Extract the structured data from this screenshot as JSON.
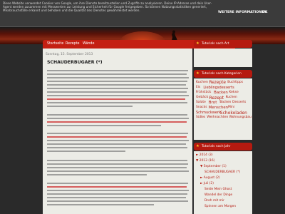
{
  "cookie": {
    "text": "Diese Website verwendet Cookies von Google, um ihre Dienste bereitzustellen und Zugriffe zu analysieren. Deine IP-Adresse und dein User-Agent werden zusammen mit Messwerten zur Leistung und Sicherheit für Google freigegeben. So können Nutzungsstatistiken generiert, Missbrauchsfälle erkannt und behoben und die Qualität des Dienstes gewährleistet werden.",
    "more_label": "WEITERE INFORMATIONEN",
    "ok_label": "OK"
  },
  "nav": {
    "items": [
      "Startseite",
      "Rezepte",
      "Wände"
    ]
  },
  "post": {
    "date": "Sonntag, 15. September 2013",
    "title": "SCHAUDERBUGAER (*)"
  },
  "sidebar": {
    "widgets": [
      {
        "title": "Tutorials nach Art"
      },
      {
        "title": "Tutorials nach Kategorien"
      },
      {
        "title": "Tutorials nach Jahr"
      }
    ],
    "tags": [
      {
        "label": "Kuchen",
        "size": 4.6
      },
      {
        "label": "Rezepte",
        "size": 5.8
      },
      {
        "label": "Buchtipps",
        "size": 4.4
      },
      {
        "label": "Eis",
        "size": 4.4
      },
      {
        "label": "Lieblingsdesserts",
        "size": 5.0
      },
      {
        "label": "Frühstück",
        "size": 4.4
      },
      {
        "label": "Backen",
        "size": 5.4
      },
      {
        "label": "Kekse",
        "size": 4.6
      },
      {
        "label": "Gebäck",
        "size": 4.6
      },
      {
        "label": "Rezept",
        "size": 6.0
      },
      {
        "label": "Kuchen",
        "size": 4.4
      },
      {
        "label": "Salate",
        "size": 4.4
      },
      {
        "label": "Brot",
        "size": 5.6
      },
      {
        "label": "Backen",
        "size": 4.4
      },
      {
        "label": "Desserts",
        "size": 4.4
      },
      {
        "label": "Snacks",
        "size": 4.4
      },
      {
        "label": "Menschen",
        "size": 5.4
      },
      {
        "label": "Mini",
        "size": 4.4
      },
      {
        "label": "Schmuckwerk",
        "size": 5.0
      },
      {
        "label": "Schokoladen",
        "size": 6.0
      },
      {
        "label": "Süßes",
        "size": 4.4
      },
      {
        "label": "Weihnachten",
        "size": 4.6
      },
      {
        "label": "Wohnungsbau",
        "size": 4.4
      }
    ],
    "archive": [
      "► 2014 (3)",
      "▼ 2013 (16)",
      "▼ September (1)",
      "SCHAUDERBUGAER (*)",
      "► August (2)",
      "► Juli (2)",
      "Seide Mein Ghost",
      "Wandel der Dinge",
      "Dreh mit mir",
      "Spinnen am Morgen"
    ]
  }
}
